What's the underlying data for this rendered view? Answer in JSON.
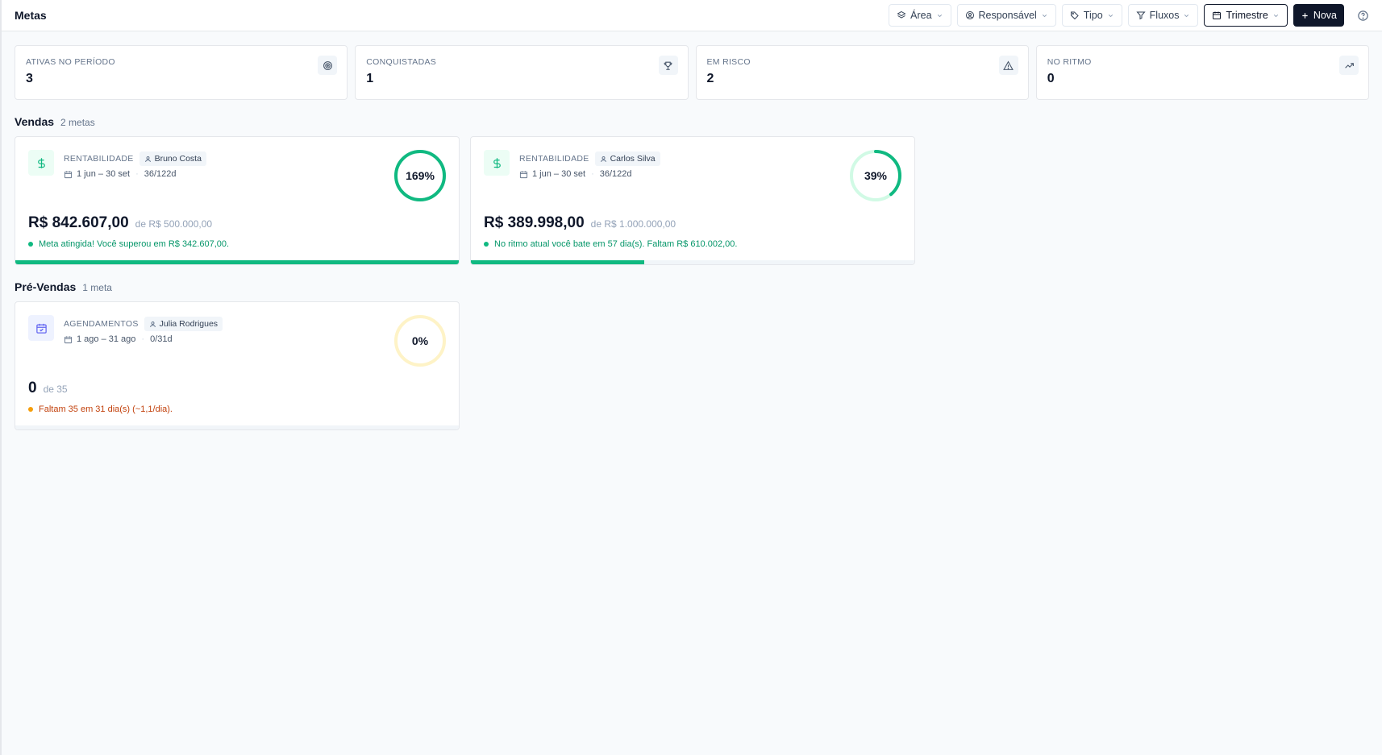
{
  "header": {
    "title": "Metas",
    "filters": {
      "area": "Área",
      "responsavel": "Responsável",
      "tipo": "Tipo",
      "fluxos": "Fluxos",
      "periodo": "Trimestre"
    },
    "new_label": "Nova"
  },
  "kpis": [
    {
      "label": "ATIVAS NO PERÍODO",
      "value": "3",
      "icon": "target-icon"
    },
    {
      "label": "CONQUISTADAS",
      "value": "1",
      "icon": "trophy-icon"
    },
    {
      "label": "EM RISCO",
      "value": "2",
      "icon": "alert-triangle-icon"
    },
    {
      "label": "NO RITMO",
      "value": "0",
      "icon": "trending-up-icon"
    }
  ],
  "sections": [
    {
      "title": "Vendas",
      "count": "2 metas",
      "goals": [
        {
          "icon": "dollar-icon",
          "type": "RENTABILIDADE",
          "owner": "Bruno Costa",
          "period": "1 jun – 30 set",
          "elapsed": "36/122d",
          "percent_label": "169%",
          "percent": 1.69,
          "amount": "R$ 842.607,00",
          "target": "de R$ 500.000,00",
          "status": "Meta atingida! Você superou em R$ 342.607,00.",
          "status_color": "#059669",
          "dot_color": "#10b981",
          "ring_color": "#10b981",
          "ring_track": "#d1fae5",
          "progress": 1.0
        },
        {
          "icon": "dollar-icon",
          "type": "RENTABILIDADE",
          "owner": "Carlos Silva",
          "period": "1 jun – 30 set",
          "elapsed": "36/122d",
          "percent_label": "39%",
          "percent": 0.39,
          "amount": "R$ 389.998,00",
          "target": "de R$ 1.000.000,00",
          "status": "No ritmo atual você bate em 57 dia(s). Faltam R$ 610.002,00.",
          "status_color": "#059669",
          "dot_color": "#10b981",
          "ring_color": "#10b981",
          "ring_track": "#d1fae5",
          "progress": 0.39
        }
      ]
    },
    {
      "title": "Pré-Vendas",
      "count": "1 meta",
      "goals": [
        {
          "icon": "calendar-check-icon",
          "type": "AGENDAMENTOS",
          "owner": "Julia Rodrigues",
          "period": "1 ago – 31 ago",
          "elapsed": "0/31d",
          "percent_label": "0%",
          "percent": 0,
          "amount": "0",
          "target": "de 35",
          "status": "Faltam 35 em 31 dia(s) (~1,1/dia).",
          "status_color": "#c2410c",
          "dot_color": "#f59e0b",
          "ring_color": "#f59e0b",
          "ring_track": "#fef3c7",
          "progress": 0
        }
      ]
    }
  ]
}
